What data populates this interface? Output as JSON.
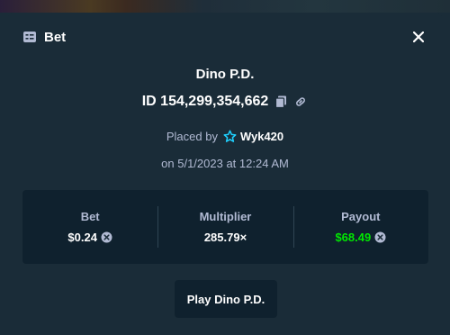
{
  "modal": {
    "title": "Bet",
    "close_label": "×"
  },
  "bet": {
    "game_name": "Dino P.D.",
    "id_text": "ID 154,299,354,662",
    "placed_by_label": "Placed by",
    "username": "Wyk420",
    "date_text": "on 5/1/2023 at 12:24 AM"
  },
  "stats": {
    "bet_label": "Bet",
    "bet_value": "$0.24",
    "multiplier_label": "Multiplier",
    "multiplier_value": "285.79×",
    "payout_label": "Payout",
    "payout_value": "$68.49"
  },
  "actions": {
    "play_label": "Play Dino P.D."
  },
  "colors": {
    "background": "#1a2c38",
    "panel": "#0f212e",
    "muted_text": "#b1bad3",
    "payout_green": "#00e701",
    "star": "#1fd1ff"
  }
}
